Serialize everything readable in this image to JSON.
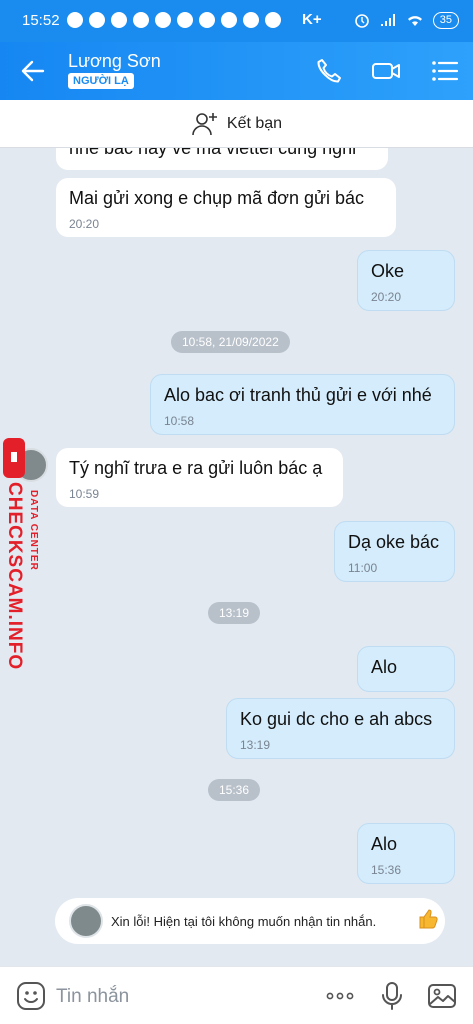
{
  "status_bar": {
    "time": "15:52",
    "carrier_badge": "K+",
    "battery": "35"
  },
  "header": {
    "contact_name": "Lương Sơn",
    "badge": "NGƯỜI LẠ"
  },
  "add_friend_label": "Kết bạn",
  "messages": [
    {
      "side": "in",
      "text": "nhé bác hay về mã viettel cũng nghỉ",
      "time": ""
    },
    {
      "side": "in",
      "text": "Mai gửi xong e chụp mã đơn gửi bác",
      "time": "20:20"
    },
    {
      "side": "out",
      "text": "Oke",
      "time": "20:20"
    },
    {
      "side": "out",
      "text": "Alo bac ơi tranh thủ gửi e với nhé",
      "time": "10:58"
    },
    {
      "side": "in",
      "text": "Tý nghĩ trưa e ra gửi luôn bác ạ",
      "time": "10:59"
    },
    {
      "side": "out",
      "text": "Dạ oke bác",
      "time": "11:00"
    },
    {
      "side": "out",
      "text": "Alo",
      "time": ""
    },
    {
      "side": "out",
      "text": "Ko gui dc cho e ah abcs",
      "time": "13:19"
    },
    {
      "side": "out",
      "text": "Alo",
      "time": "15:36"
    }
  ],
  "date_chips": [
    "10:58, 21/09/2022",
    "13:19",
    "15:36"
  ],
  "watermark": {
    "brand": "CHECKSCAM.INFO",
    "sub": "DATA CENTER"
  },
  "bottom_notice": "Xin lỗi! Hiện tại tôi không muốn nhận tin nhắn.",
  "input": {
    "placeholder": "Tin nhắn"
  },
  "colors": {
    "header_blue": "#1a8cf0",
    "chat_bg": "#e2e9f1",
    "outgoing_bubble": "#d4ecfb",
    "watermark_red": "#e3202a"
  }
}
